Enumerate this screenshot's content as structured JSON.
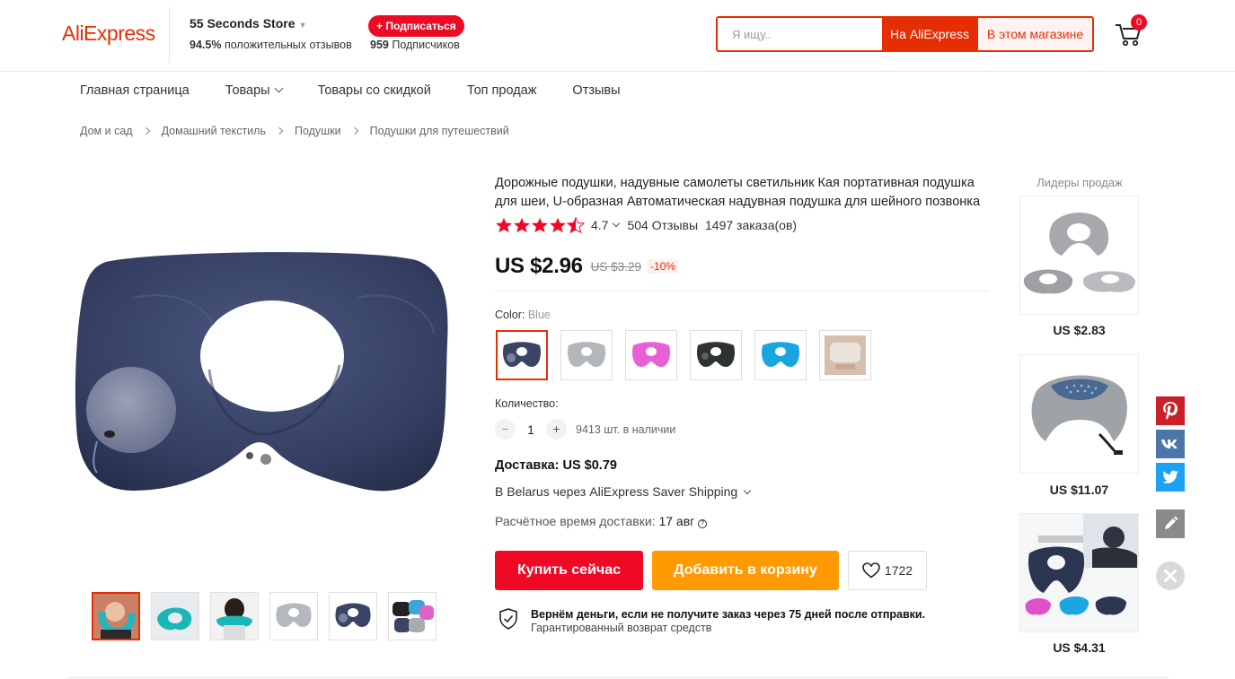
{
  "header": {
    "logo": "AliExpress",
    "store_name": "55 Seconds Store",
    "rating_pct": "94.5%",
    "rating_text": "положительных отзывов",
    "subscribe_label": "+ Подписаться",
    "subscribers_count": "959",
    "subscribers_text": "Подписчиков",
    "search_placeholder": "Я ищу..",
    "search_ae_label": "На AliExpress",
    "search_store_label": "В этом магазине",
    "cart_count": "0"
  },
  "nav": {
    "items": [
      "Главная страница",
      "Товары",
      "Товары со скидкой",
      "Топ продаж",
      "Отзывы"
    ]
  },
  "breadcrumb": [
    "Дом и сад",
    "Домашний текстиль",
    "Подушки",
    "Подушки для путешествий"
  ],
  "product": {
    "title": "Дорожные подушки, надувные самолеты светильник Кая портативная подушка для шеи, U-образная Автоматическая надувная подушка для шейного позвонка",
    "rating": "4.7",
    "reviews": "504 Отзывы",
    "orders": "1497 заказа(ов)",
    "price": "US $2.96",
    "old_price": "US $3.29",
    "discount": "-10%",
    "color_label": "Color:",
    "color_value": "Blue",
    "qty_label": "Количество:",
    "qty_minus": "−",
    "qty_value": "1",
    "qty_plus": "+",
    "stock": "9413 шт. в наличии",
    "shipping_title": "Доставка: US $0.79",
    "shipping_method": "В Belarus через AliExpress Saver Shipping",
    "delivery_label": "Расчётное время доставки:",
    "delivery_date": "17 авг",
    "buy_label": "Купить сейчас",
    "cart_label": "Добавить в корзину",
    "wishlist_count": "1722",
    "guarantee_main": "Вернём деньги, если не получите заказ через 75 дней после отправки.",
    "guarantee_sub": "Гарантированный возврат средств"
  },
  "colors": {
    "navy": "#3a4566",
    "accent": "#e62e04",
    "buy": "#ee0a24",
    "cart": "#ff9a00"
  },
  "leaders": {
    "title": "Лидеры продаж",
    "items": [
      {
        "price": "US $2.83"
      },
      {
        "price": "US $11.07"
      },
      {
        "price": "US $4.31"
      }
    ]
  },
  "social": [
    "pinterest-icon",
    "vk-icon",
    "twitter-icon",
    "edit-icon",
    "close-icon"
  ]
}
